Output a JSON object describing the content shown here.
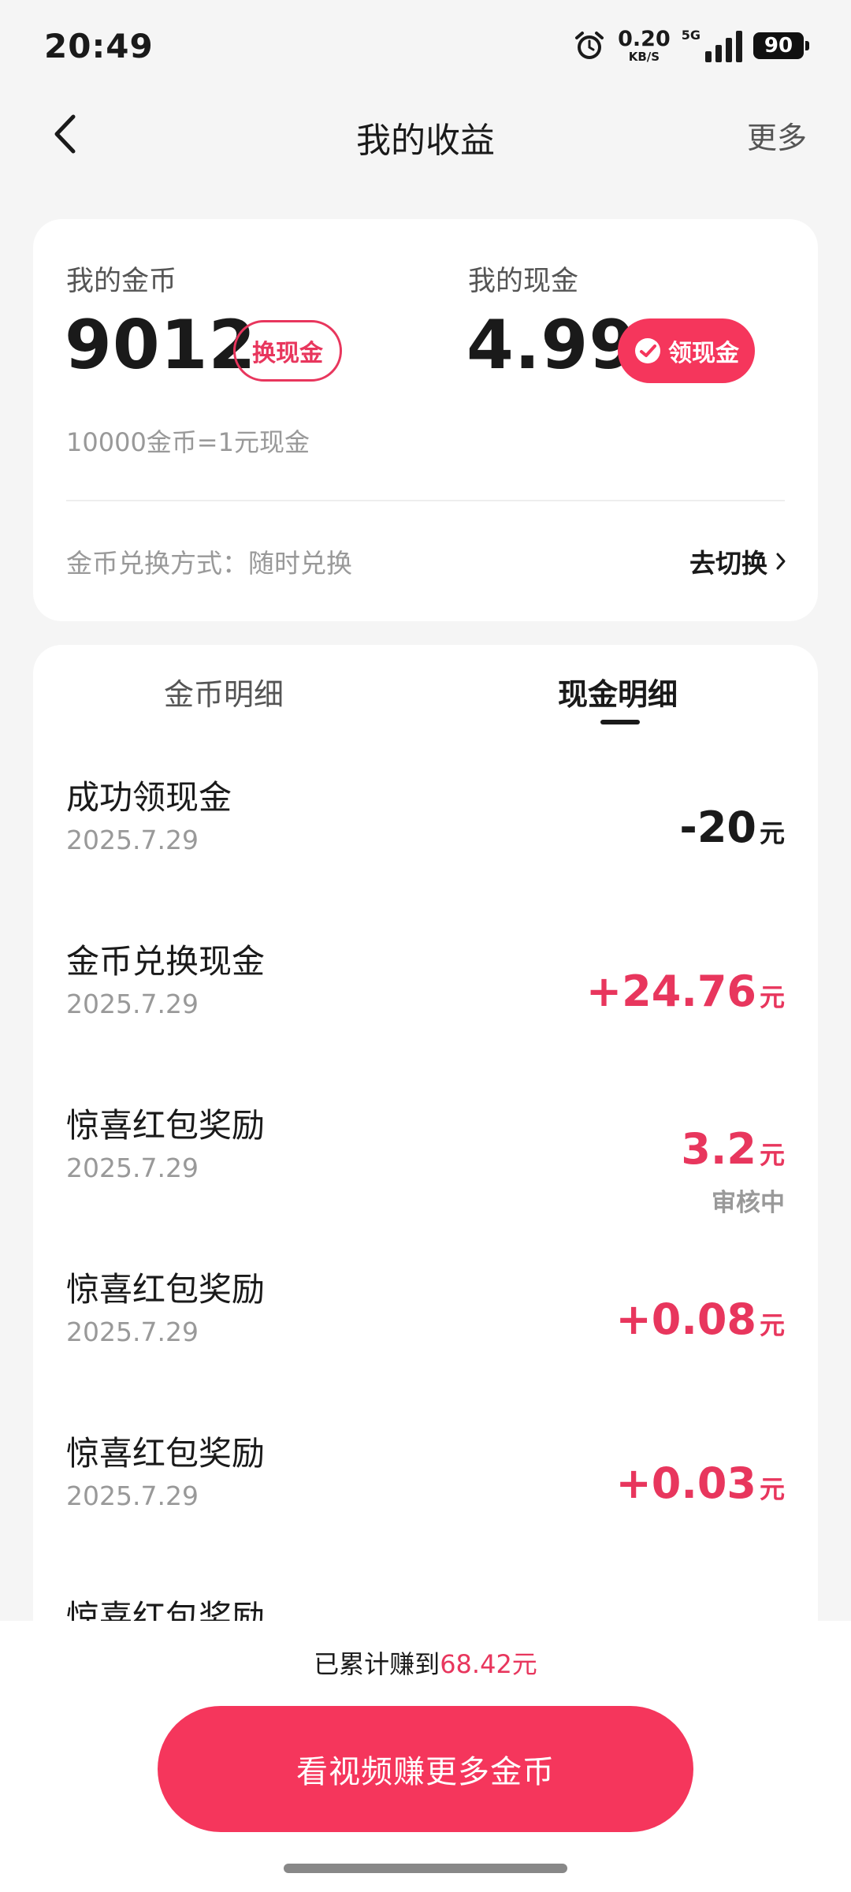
{
  "status_bar": {
    "time": "20:49",
    "net_speed_value": "0.20",
    "net_speed_unit": "KB/S",
    "network": "5G",
    "battery": "90"
  },
  "header": {
    "title": "我的收益",
    "more": "更多"
  },
  "summary": {
    "coins_label": "我的金币",
    "coins_value": "9012",
    "exchange_button": "换现金",
    "cash_label": "我的现金",
    "cash_value": "4.99",
    "withdraw_button": "领现金",
    "rate_text": "10000金币=1元现金",
    "method_text": "金币兑换方式：随时兑换",
    "switch_text": "去切换"
  },
  "tabs": {
    "coin_detail": "金币明细",
    "cash_detail": "现金明细"
  },
  "records": [
    {
      "title": "成功领现金",
      "date": "2025.7.29",
      "amount": "-20",
      "unit": "元",
      "status": ""
    },
    {
      "title": "金币兑换现金",
      "date": "2025.7.29",
      "amount": "+24.76",
      "unit": "元",
      "status": ""
    },
    {
      "title": "惊喜红包奖励",
      "date": "2025.7.29",
      "amount": "3.2",
      "unit": "元",
      "status": "审核中"
    },
    {
      "title": "惊喜红包奖励",
      "date": "2025.7.29",
      "amount": "+0.08",
      "unit": "元",
      "status": ""
    },
    {
      "title": "惊喜红包奖励",
      "date": "2025.7.29",
      "amount": "+0.03",
      "unit": "元",
      "status": ""
    },
    {
      "title": "惊喜红包奖励",
      "date": "",
      "amount": "",
      "unit": "",
      "status": ""
    }
  ],
  "footer": {
    "earned_prefix": "已累计赚到",
    "earned_amount": "68.42元",
    "cta": "看视频赚更多金币"
  },
  "colors": {
    "accent": "#f5365c",
    "accent_text": "#e8365d",
    "background": "#f5f5f5"
  },
  "icons": [
    "alarm-icon",
    "signal-icon",
    "battery-icon",
    "back-icon",
    "wallet-icon",
    "chevron-right-icon"
  ]
}
